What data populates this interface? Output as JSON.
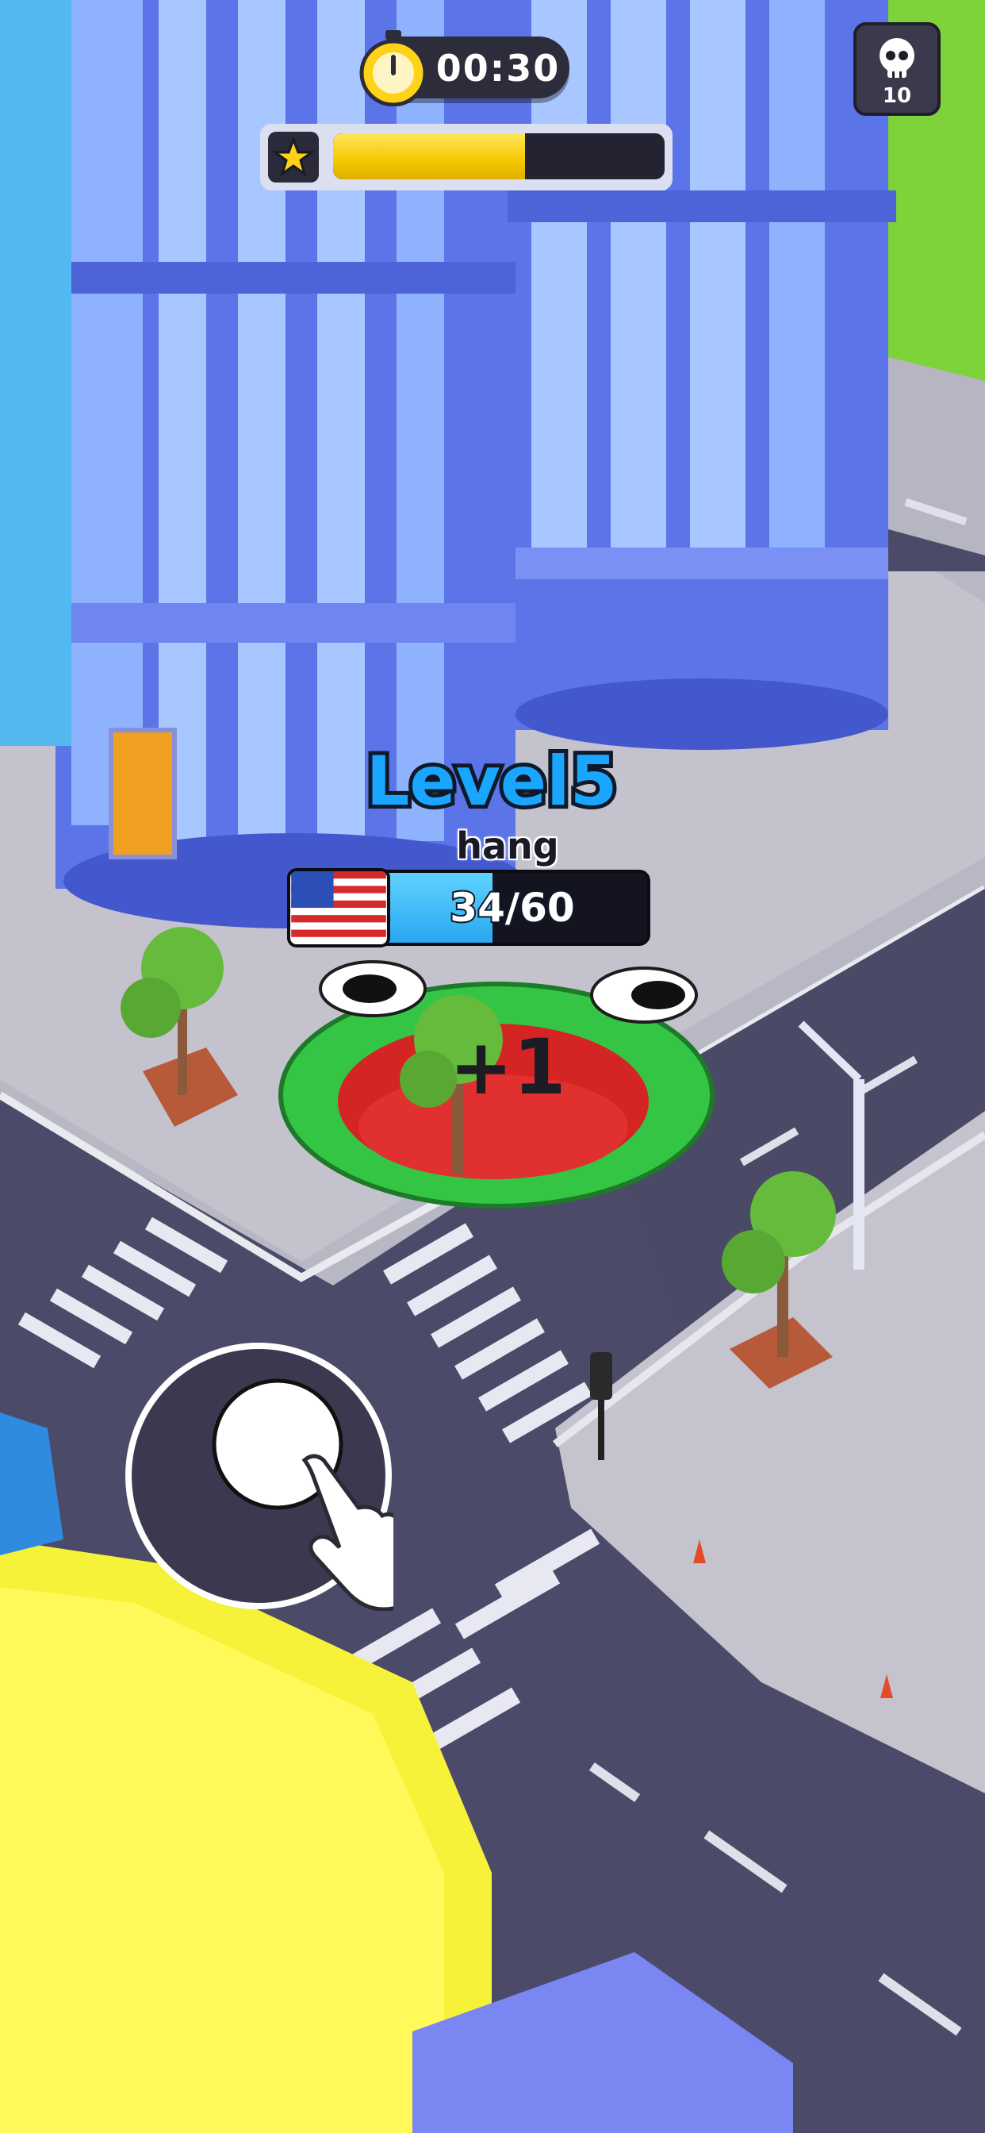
{
  "hud": {
    "timer": "00:30",
    "stopwatch_icon": "stopwatch-icon",
    "star_icon": "star-icon",
    "skull_icon": "skull-icon",
    "kill_count": "10",
    "star_progress": 0.58
  },
  "player": {
    "level": "Level5",
    "name": "hang",
    "progress_text": "34/60",
    "progress_fraction": 0.567,
    "flag_icon": "us-flag-icon",
    "score_popup": "+1"
  },
  "controls": {
    "joystick_icon": "joystick-icon",
    "hand_icon": "pointing-hand-icon"
  },
  "colors": {
    "accent_yellow": "#f5c800",
    "accent_blue": "#2aa7f0",
    "hole_green": "#3ad14a",
    "road": "#4a4a66"
  }
}
